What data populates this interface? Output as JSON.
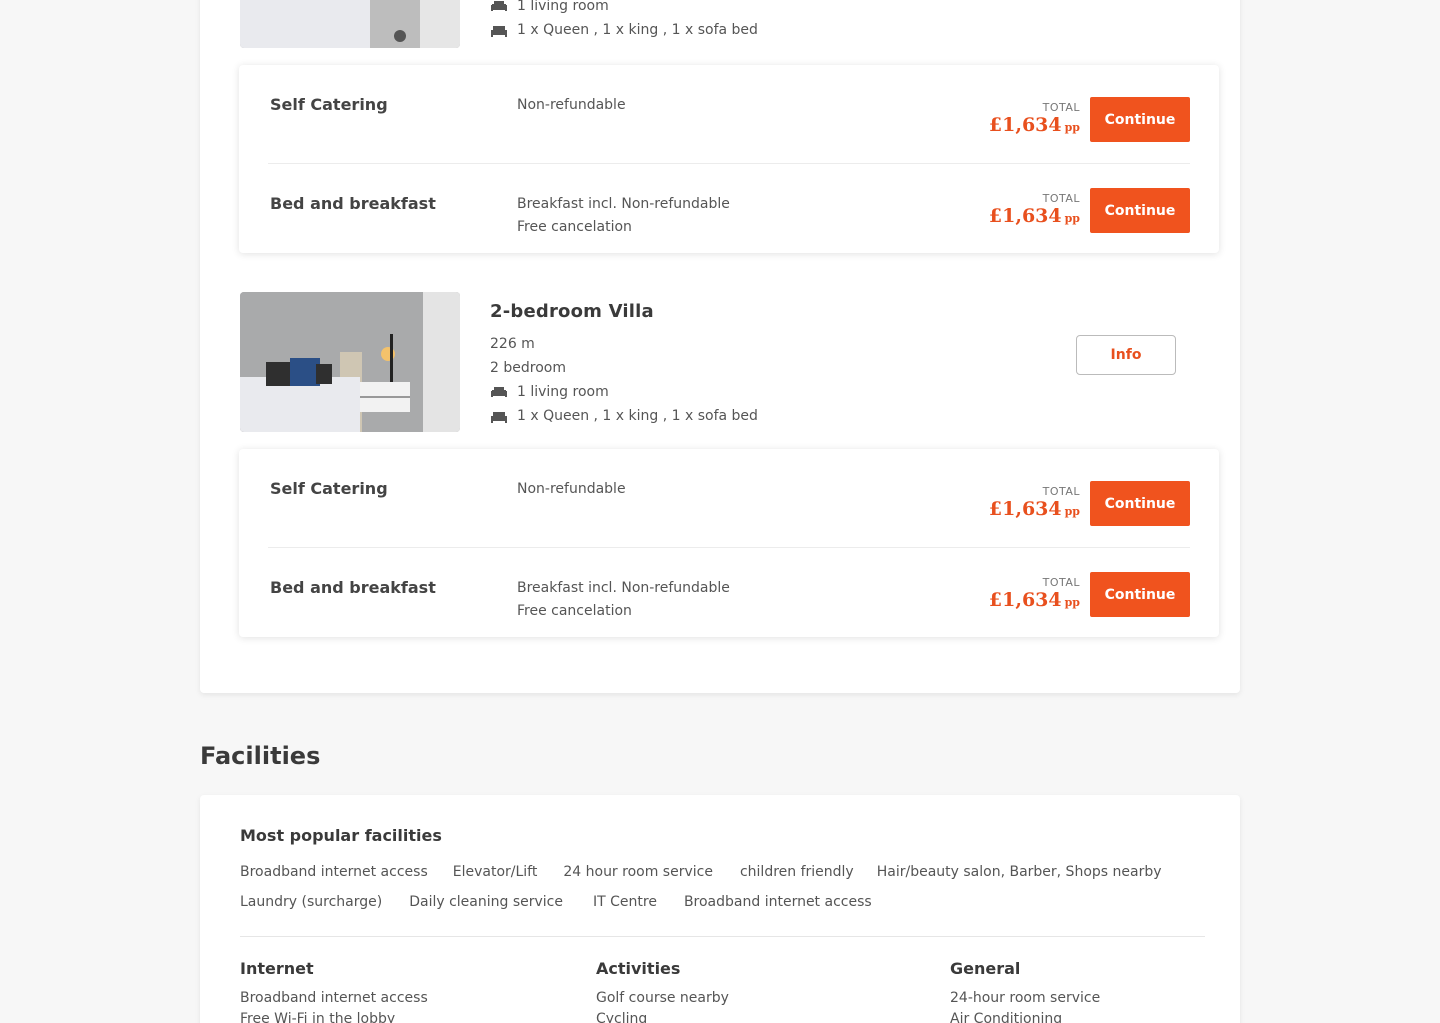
{
  "rooms": [
    {
      "lines": [
        {
          "icon": "sofa-icon",
          "text": "1 living room"
        },
        {
          "icon": "bed-icon",
          "text": "1 x Queen , 1 x king , 1 x sofa bed"
        }
      ],
      "rates": [
        {
          "name": "Self Catering",
          "desc": [
            "Non-refundable"
          ],
          "total_label": "TOTAL",
          "price": "£1,634",
          "unit": "pp",
          "button": "Continue"
        },
        {
          "name": "Bed and breakfast",
          "desc": [
            "Breakfast incl. Non-refundable",
            "Free cancelation"
          ],
          "total_label": "TOTAL",
          "price": "£1,634",
          "unit": "pp",
          "button": "Continue"
        }
      ]
    },
    {
      "title": "2-bedroom Villa",
      "size": "226 m",
      "bedrooms": "2 bedroom",
      "lines": [
        {
          "icon": "sofa-icon",
          "text": "1 living room"
        },
        {
          "icon": "bed-icon",
          "text": "1 x Queen , 1 x king , 1 x sofa bed"
        }
      ],
      "info_button": "Info",
      "rates": [
        {
          "name": "Self Catering",
          "desc": [
            "Non-refundable"
          ],
          "total_label": "TOTAL",
          "price": "£1,634",
          "unit": "pp",
          "button": "Continue"
        },
        {
          "name": "Bed and breakfast",
          "desc": [
            "Breakfast incl. Non-refundable",
            "Free cancelation"
          ],
          "total_label": "TOTAL",
          "price": "£1,634",
          "unit": "pp",
          "button": "Continue"
        }
      ]
    }
  ],
  "facilities": {
    "heading": "Facilities",
    "popular_title": "Most popular facilities",
    "popular": [
      "Broadband internet access",
      "Elevator/Lift",
      "24 hour room service",
      "children friendly",
      "Hair/beauty salon, Barber, Shops nearby",
      "Laundry (surcharge)",
      "Daily cleaning service",
      "IT Centre",
      "Broadband internet access"
    ],
    "columns": [
      {
        "title": "Internet",
        "items": [
          "Broadband internet access",
          "Free Wi-Fi in the lobby"
        ]
      },
      {
        "title": "Activities",
        "items": [
          "Golf course nearby",
          "Cycling"
        ]
      },
      {
        "title": "General",
        "items": [
          "24-hour room service",
          "Air Conditioning"
        ]
      }
    ]
  },
  "colors": {
    "accent": "#f0531e",
    "price": "#e8501e"
  }
}
